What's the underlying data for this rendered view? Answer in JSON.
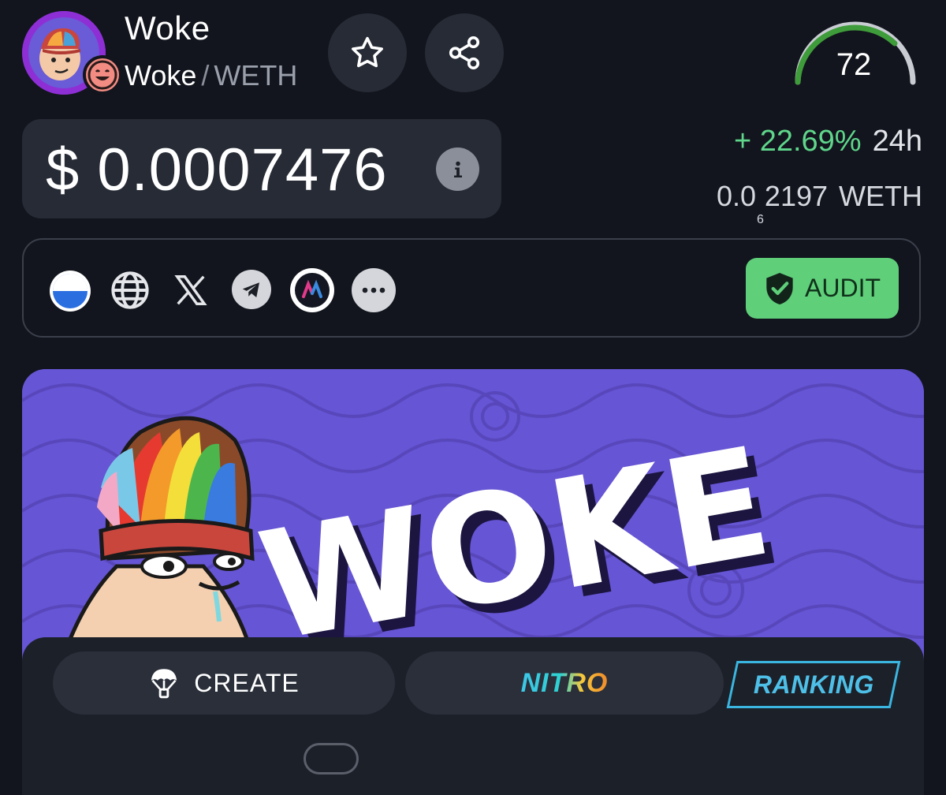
{
  "header": {
    "token_name": "Woke",
    "pair_base": "Woke",
    "pair_separator": "/",
    "pair_quote": "WETH",
    "favorite_icon": "star-icon",
    "share_icon": "share-icon",
    "score": "72"
  },
  "price": {
    "usd": "$ 0.0007476",
    "info_icon": "info-icon",
    "change_pct": "+ 22.69%",
    "timeframe": "24h",
    "weth_prefix": "0.0",
    "weth_subscript": "6",
    "weth_digits": "2197",
    "weth_unit": "WETH"
  },
  "links": {
    "icons": [
      "chain-icon",
      "globe-icon",
      "x-icon",
      "telegram-icon",
      "app-icon",
      "more-icon"
    ],
    "audit_label": "AUDIT"
  },
  "banner": {
    "logo_text": "WOKE"
  },
  "actions": {
    "create_label": "CREATE",
    "nitro_label": "NITRO",
    "ranking_label": "RANKING"
  },
  "colors": {
    "background": "#12151d",
    "card": "#262b35",
    "positive": "#5fd68b",
    "audit": "#5fcf7a",
    "banner": "#6655d4",
    "ranking": "#4ec0e8"
  }
}
